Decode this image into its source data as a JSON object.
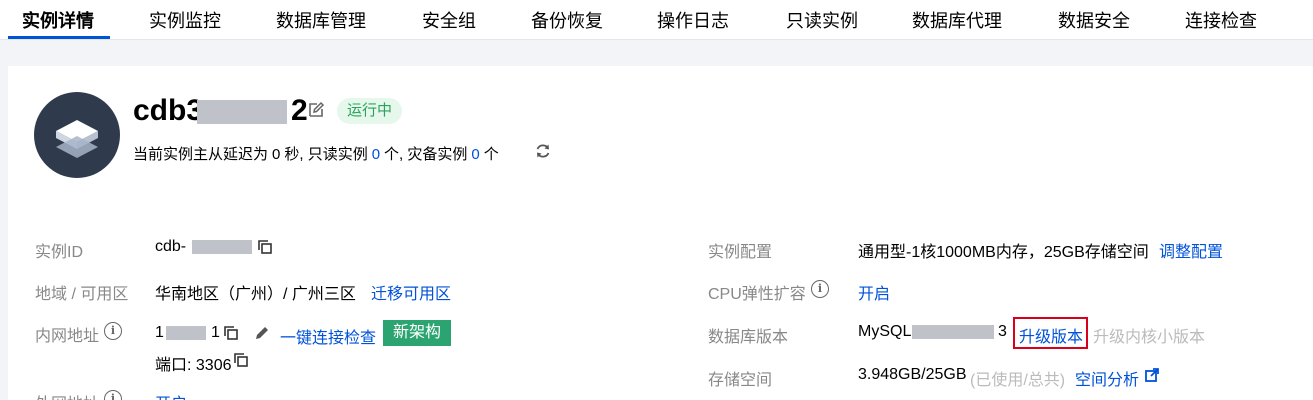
{
  "tabs": [
    "实例详情",
    "实例监控",
    "数据库管理",
    "安全组",
    "备份恢复",
    "操作日志",
    "只读实例",
    "数据库代理",
    "数据安全",
    "连接检查"
  ],
  "instance": {
    "name_prefix": "cdb3",
    "name_suffix": "2",
    "status": "运行中"
  },
  "summary": {
    "part1": "当前实例主从延迟为",
    "delay": "0",
    "part2": "秒, 只读实例",
    "readonly_count": "0",
    "part3": "个, 灾备实例",
    "dr_count": "0",
    "part4": "个"
  },
  "left_fields": {
    "id_label": "实例ID",
    "id_value": "cdb-",
    "region_label": "地域 / 可用区",
    "region_value": "华南地区（广州）/ 广州三区",
    "region_link": "迁移可用区",
    "vip_label": "内网地址",
    "vip_prefix": "1",
    "vip_suffix": "1",
    "vip_link": "一键连接检查",
    "vip_badge": "新架构",
    "port": "端口: 3306",
    "wan_label": "外网地址",
    "wan_link": "开启"
  },
  "right_fields": {
    "config_label": "实例配置",
    "config_value": "通用型-1核1000MB内存，25GB存储空间",
    "config_link": "调整配置",
    "cpu_label": "CPU弹性扩容",
    "cpu_link": "开启",
    "version_label": "数据库版本",
    "version_prefix": "MySQL",
    "version_suffix": "3",
    "upgrade_link": "升级版本",
    "upgrade_minor": "升级内核小版本",
    "storage_label": "存储空间",
    "storage_value": "3.948GB/25GB",
    "storage_note": "(已使用/总共)",
    "storage_link": "空间分析"
  },
  "colors": {
    "brand": "#0052d9",
    "status_green": "#29a35a",
    "badge_green": "#2ba471",
    "highlight_red": "#d9001b"
  }
}
